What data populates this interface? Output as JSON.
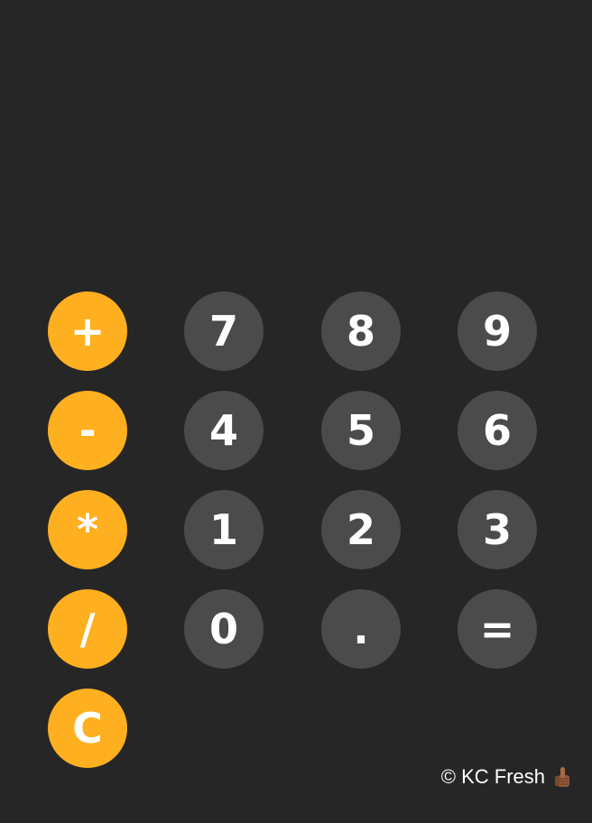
{
  "display": {
    "value": ""
  },
  "keys": {
    "plus": "+",
    "minus": "-",
    "multiply": "*",
    "divide": "/",
    "clear": "C",
    "seven": "7",
    "eight": "8",
    "nine": "9",
    "four": "4",
    "five": "5",
    "six": "6",
    "one": "1",
    "two": "2",
    "three": "3",
    "zero": "0",
    "decimal": ".",
    "equals": "="
  },
  "footer": {
    "credit": "© KC Fresh",
    "icon": "thumbs-up-icon"
  },
  "colors": {
    "background": "#262626",
    "operator_key": "#ffb020",
    "number_key": "#4b4b4b",
    "text": "#ffffff"
  }
}
